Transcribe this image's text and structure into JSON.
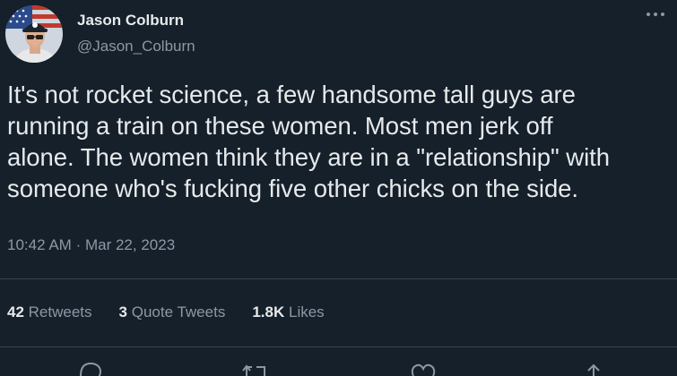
{
  "author": {
    "display_name": "Jason Colburn",
    "handle": "@Jason_Colburn",
    "avatar_icon": "profile-photo"
  },
  "more_icon": "more-horizontal-icon",
  "tweet": {
    "text": "It's not rocket science, a few handsome tall guys are\nrunning a train on these women. Most men jerk off\nalone. The women think they are in a \"relationship\" with\nsomeone who's fucking five other chicks on the side.",
    "time": "10:42 AM",
    "separator": "·",
    "date": "Mar 22, 2023"
  },
  "stats": {
    "retweets_count": "42",
    "retweets_label": "Retweets",
    "quotes_count": "3",
    "quotes_label": "Quote Tweets",
    "likes_count": "1.8K",
    "likes_label": "Likes"
  },
  "actions": {
    "reply_icon": "reply-icon",
    "retweet_icon": "retweet-icon",
    "like_icon": "like-icon",
    "share_icon": "share-icon"
  },
  "colors": {
    "background": "#15202b",
    "text_primary": "#e7e9ea",
    "text_secondary": "#8b98a5",
    "divider": "#38444d"
  }
}
